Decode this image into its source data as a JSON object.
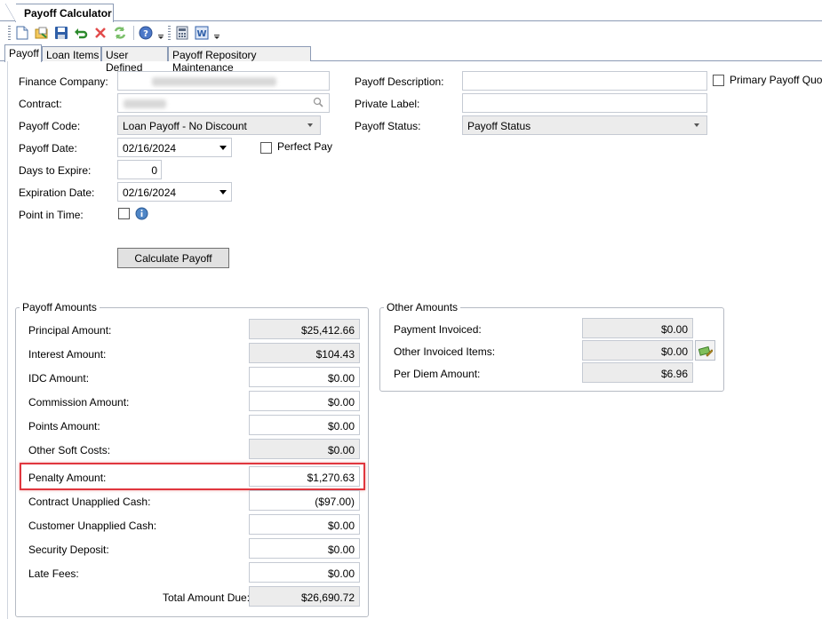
{
  "window": {
    "doc_tab": "Payoff Calculator"
  },
  "toolbar": {
    "icons": [
      "new-document-icon",
      "open-folder-icon",
      "save-icon",
      "undo-icon",
      "delete-icon",
      "refresh-icon",
      "help-icon",
      "calculator-icon",
      "word-icon"
    ]
  },
  "tabs": [
    {
      "label": "Payoff",
      "active": true
    },
    {
      "label": "Loan Items"
    },
    {
      "label": "User Defined"
    },
    {
      "label": "Payoff Repository Maintenance"
    }
  ],
  "form": {
    "finance_company": {
      "label": "Finance Company:"
    },
    "contract": {
      "label": "Contract:"
    },
    "payoff_code": {
      "label": "Payoff Code:",
      "value": "Loan Payoff - No Discount"
    },
    "payoff_date": {
      "label": "Payoff Date:",
      "value": "02/16/2024"
    },
    "perfect_pay": {
      "label": "Perfect Pay",
      "checked": false
    },
    "days_to_expire": {
      "label": "Days to Expire:",
      "value": "0"
    },
    "expiration_date": {
      "label": "Expiration Date:",
      "value": "02/16/2024"
    },
    "point_in_time": {
      "label": "Point in Time:",
      "checked": false
    },
    "payoff_description": {
      "label": "Payoff Description:",
      "value": ""
    },
    "primary_payoff_quote": {
      "label": "Primary Payoff Quote",
      "checked": false
    },
    "private_label": {
      "label": "Private Label:",
      "value": ""
    },
    "payoff_status": {
      "label": "Payoff Status:",
      "value": "Payoff Status"
    },
    "calculate_button": "Calculate Payoff"
  },
  "payoff_amounts": {
    "title": "Payoff Amounts",
    "rows": [
      {
        "label": "Principal Amount:",
        "value": "$25,412.66",
        "readonly": true
      },
      {
        "label": "Interest Amount:",
        "value": "$104.43",
        "readonly": true
      },
      {
        "label": "IDC Amount:",
        "value": "$0.00",
        "readonly": false
      },
      {
        "label": "Commission Amount:",
        "value": "$0.00",
        "readonly": false
      },
      {
        "label": "Points Amount:",
        "value": "$0.00",
        "readonly": false
      },
      {
        "label": "Other Soft Costs:",
        "value": "$0.00",
        "readonly": true
      },
      {
        "label": "Penalty Amount:",
        "value": "$1,270.63",
        "readonly": false,
        "highlighted": true
      },
      {
        "label": "Contract Unapplied Cash:",
        "value": "($97.00)",
        "readonly": false
      },
      {
        "label": "Customer Unapplied Cash:",
        "value": "$0.00",
        "readonly": false
      },
      {
        "label": "Security Deposit:",
        "value": "$0.00",
        "readonly": false
      },
      {
        "label": "Late Fees:",
        "value": "$0.00",
        "readonly": false
      }
    ],
    "total": {
      "label": "Total Amount Due:",
      "value": "$26,690.72"
    }
  },
  "other_amounts": {
    "title": "Other Amounts",
    "rows": [
      {
        "label": "Payment Invoiced:",
        "value": "$0.00"
      },
      {
        "label": "Other Invoiced Items:",
        "value": "$0.00"
      },
      {
        "label": "Per Diem Amount:",
        "value": "$6.96"
      }
    ]
  },
  "colors": {
    "highlight": "#e0363e",
    "readonly_bg": "#ececec",
    "border": "#8c9bb5"
  }
}
